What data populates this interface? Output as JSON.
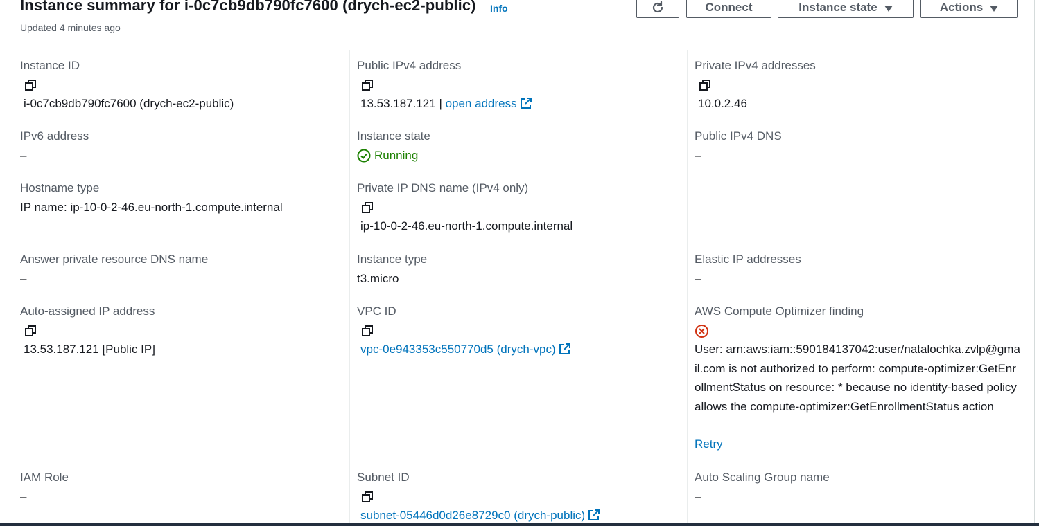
{
  "header": {
    "title": "Instance summary for i-0c7cb9db790fc7600 (drych-ec2-public)",
    "info_label": "Info",
    "updated_text": "Updated 4 minutes ago",
    "buttons": {
      "connect": "Connect",
      "instance_state": "Instance state",
      "actions": "Actions"
    }
  },
  "fields": {
    "instance_id": {
      "label": "Instance ID",
      "value": "i-0c7cb9db790fc7600 (drych-ec2-public)"
    },
    "public_ipv4": {
      "label": "Public IPv4 address",
      "value": "13.53.187.121 |",
      "link": "open address"
    },
    "private_ipv4": {
      "label": "Private IPv4 addresses",
      "value": "10.0.2.46"
    },
    "ipv6": {
      "label": "IPv6 address",
      "value": "–"
    },
    "instance_state": {
      "label": "Instance state",
      "value": "Running"
    },
    "public_dns": {
      "label": "Public IPv4 DNS",
      "value": "–"
    },
    "hostname_type": {
      "label": "Hostname type",
      "value": "IP name: ip-10-0-2-46.eu-north-1.compute.internal"
    },
    "private_dns": {
      "label": "Private IP DNS name (IPv4 only)",
      "value": "ip-10-0-2-46.eu-north-1.compute.internal"
    },
    "answer_dns": {
      "label": "Answer private resource DNS name",
      "value": "–"
    },
    "instance_type": {
      "label": "Instance type",
      "value": "t3.micro"
    },
    "elastic_ip": {
      "label": "Elastic IP addresses",
      "value": "–"
    },
    "auto_ip": {
      "label": "Auto-assigned IP address",
      "value": "13.53.187.121 [Public IP]"
    },
    "vpc_id": {
      "label": "VPC ID",
      "value": "vpc-0e943353c550770d5 (drych-vpc)"
    },
    "optimizer": {
      "label": "AWS Compute Optimizer finding",
      "value": "User: arn:aws:iam::590184137042:user/natalochka.zvlp@gmail.com is not authorized to perform: compute-optimizer:GetEnrollmentStatus on resource: * because no identity-based policy allows the compute-optimizer:GetEnrollmentStatus action",
      "retry": "Retry"
    },
    "iam_role": {
      "label": "IAM Role",
      "value": "–"
    },
    "subnet_id": {
      "label": "Subnet ID",
      "value": "subnet-05446d0d26e8729c0 (drych-public)"
    },
    "asg_name": {
      "label": "Auto Scaling Group name",
      "value": "–"
    }
  },
  "colors": {
    "link": "#0073bb",
    "running": "#1d8102",
    "error": "#d13212",
    "label": "#545b64",
    "text": "#16191f"
  },
  "icons": {
    "copy": "copy-icon",
    "external": "external-link-icon",
    "refresh": "refresh-icon",
    "status_ok": "check-circle-icon",
    "status_error": "error-circle-icon"
  }
}
